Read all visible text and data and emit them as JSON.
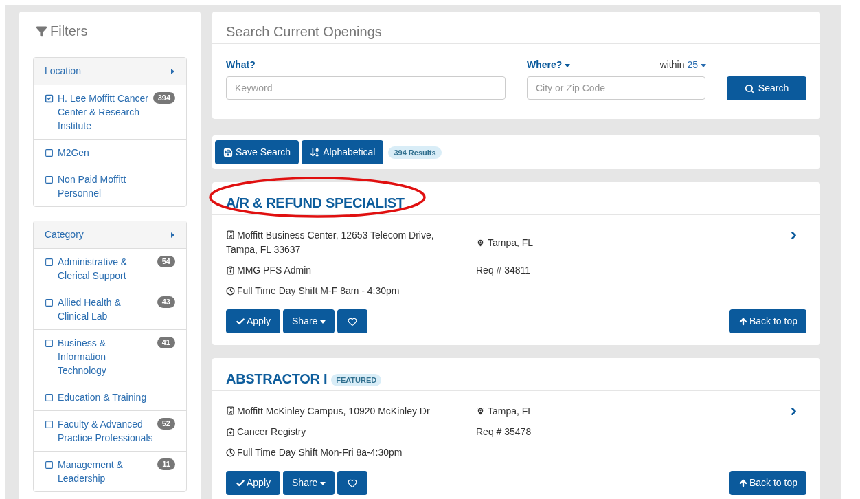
{
  "filters": {
    "title": "Filters",
    "groups": [
      {
        "title": "Location",
        "items": [
          {
            "label": "H. Lee Moffitt Cancer Center & Research Institute",
            "checked": true,
            "count": "394"
          },
          {
            "label": "M2Gen",
            "checked": false
          },
          {
            "label": "Non Paid Moffitt Personnel",
            "checked": false
          }
        ]
      },
      {
        "title": "Category",
        "items": [
          {
            "label": "Administrative & Clerical Support",
            "checked": false,
            "count": "54"
          },
          {
            "label": "Allied Health & Clinical Lab",
            "checked": false,
            "count": "43"
          },
          {
            "label": "Business & Information Technology",
            "checked": false,
            "count": "41"
          },
          {
            "label": "Education & Training",
            "checked": false
          },
          {
            "label": "Faculty & Advanced Practice Professionals",
            "checked": false,
            "count": "52"
          },
          {
            "label": "Management & Leadership",
            "checked": false,
            "count": "11"
          }
        ]
      }
    ]
  },
  "search": {
    "title": "Search Current Openings",
    "what": {
      "label": "What?",
      "placeholder": "Keyword"
    },
    "where": {
      "label": "Where?",
      "placeholder": "City or Zip Code"
    },
    "within": {
      "label": "within",
      "value": "25"
    },
    "button": "Search"
  },
  "toolbar": {
    "buttons": [
      {
        "kind": "save",
        "label": "Save Search"
      },
      {
        "kind": "sort",
        "label": "Alphabetical"
      }
    ],
    "results": "394 Results"
  },
  "jobs": [
    {
      "title": "A/R & REFUND SPECIALIST",
      "highlighted": true,
      "address": "Moffitt Business Center, 12653 Telecom Drive, Tampa, FL 33637",
      "location": "Tampa, FL",
      "department": "MMG PFS Admin",
      "req": "Req # 34811",
      "schedule": "Full Time Day Shift M-F 8am - 4:30pm",
      "apply": "Apply",
      "share": "Share",
      "back": "Back to top"
    },
    {
      "title": "ABSTRACTOR I",
      "badge": "FEATURED",
      "highlighted": false,
      "address": "Moffitt McKinley Campus, 10920 McKinley Dr",
      "location": "Tampa, FL",
      "department": "Cancer Registry",
      "req": "Req # 35478",
      "schedule": "Full Time Day Shift Mon-Fri 8a-4:30pm",
      "apply": "Apply",
      "share": "Share",
      "back": "Back to top"
    }
  ]
}
